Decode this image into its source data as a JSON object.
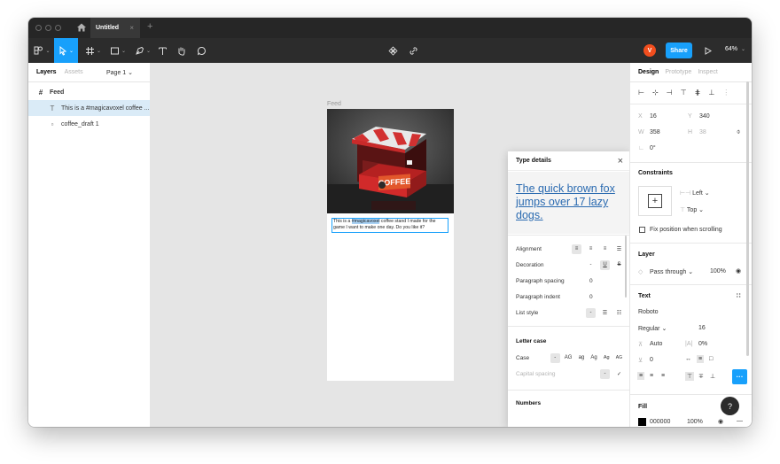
{
  "titlebar": {
    "tab_title": "Untitled",
    "tab_close": "×",
    "new_tab": "+"
  },
  "toolbar": {
    "avatar_initial": "V",
    "share_label": "Share",
    "zoom": "64%"
  },
  "left_panel": {
    "tabs": [
      "Layers",
      "Assets"
    ],
    "page": "Page 1 ⌄",
    "layers": [
      {
        "icon": "#",
        "label": "Feed"
      },
      {
        "icon": "T",
        "label": "This is a #magicavoxel coffee ..."
      },
      {
        "icon": "▫",
        "label": "coffee_draft 1"
      }
    ]
  },
  "canvas": {
    "frame_label": "Feed",
    "text_before": "This is a ",
    "text_highlight": "#magicavoxel",
    "text_after": " coffee stand I made for the game I want to make one day. Do you like it?",
    "sign_text": "COFFEE"
  },
  "type_details": {
    "title": "Type details",
    "close": "×",
    "preview": "The quick brown fox jumps over 17 lazy dogs.",
    "rows": {
      "alignment": "Alignment",
      "decoration": "Decoration",
      "paragraph_spacing": "Paragraph spacing",
      "paragraph_spacing_value": "0",
      "paragraph_indent": "Paragraph indent",
      "paragraph_indent_value": "0",
      "list_style": "List style"
    },
    "letter_case_section": "Letter case",
    "case_label": "Case",
    "case_options": [
      "-",
      "AG",
      "ag",
      "Ag",
      "Ag",
      "AG"
    ],
    "capital_spacing": "Capital spacing",
    "numbers_section": "Numbers",
    "dash": "-",
    "check": "✓",
    "u": "U",
    "s": "S"
  },
  "right_panel": {
    "tabs": [
      "Design",
      "Prototype",
      "Inspect"
    ],
    "x_label": "X",
    "x": "16",
    "y_label": "Y",
    "y": "340",
    "w_label": "W",
    "w": "358",
    "h_label": "H",
    "h": "38",
    "rotation": "0°",
    "constraints_title": "Constraints",
    "constraint_h": "Left ⌄",
    "constraint_v": "Top ⌄",
    "fix_position": "Fix position when scrolling",
    "layer_title": "Layer",
    "blend": "Pass through ⌄",
    "opacity": "100%",
    "text_title": "Text",
    "font": "Roboto",
    "weight": "Regular ⌄",
    "size": "16",
    "line_height": "Auto",
    "letter_spacing": "0%",
    "para_spacing": "0",
    "fill_title": "Fill",
    "fill_hex": "000000",
    "fill_opacity": "100%",
    "ellipsis": "···"
  },
  "help_label": "?"
}
